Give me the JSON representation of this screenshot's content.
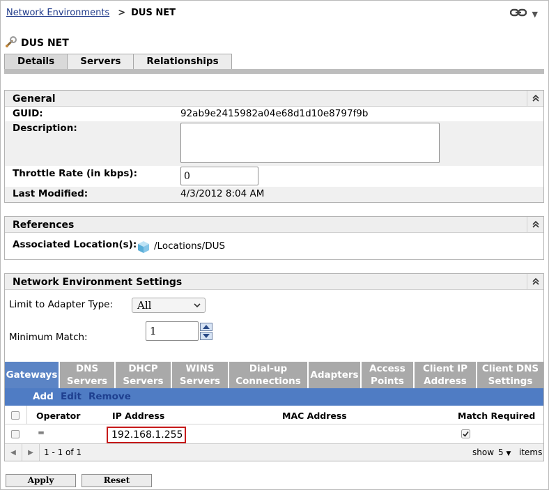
{
  "breadcrumb": {
    "parent": "Network Environments",
    "separator": ">",
    "current": "DUS NET"
  },
  "header": {
    "title": "DUS NET",
    "menu_arrow": "▼"
  },
  "tabs": [
    {
      "label": "Details"
    },
    {
      "label": "Servers"
    },
    {
      "label": "Relationships"
    }
  ],
  "general": {
    "title": "General",
    "guid_label": "GUID:",
    "guid_value": "92ab9e2415982a04e68d1d10e8797f9b",
    "description_label": "Description:",
    "description_value": "",
    "throttle_label": "Throttle Rate (in kbps):",
    "throttle_value": "0",
    "modified_label": "Last Modified:",
    "modified_value": "4/3/2012 8:04 AM"
  },
  "references": {
    "title": "References",
    "location_label": "Associated Location(s):",
    "location_value": "/Locations/DUS"
  },
  "settings": {
    "title": "Network Environment Settings",
    "adapter_label": "Limit to Adapter Type:",
    "adapter_value": "All",
    "min_match_label": "Minimum Match:",
    "min_match_value": "1",
    "subtabs": [
      {
        "line1": "Gateways",
        "line2": ""
      },
      {
        "line1": "DNS",
        "line2": "Servers"
      },
      {
        "line1": "DHCP",
        "line2": "Servers"
      },
      {
        "line1": "WINS",
        "line2": "Servers"
      },
      {
        "line1": "Dial-up",
        "line2": "Connections"
      },
      {
        "line1": "Adapters",
        "line2": ""
      },
      {
        "line1": "Access",
        "line2": "Points"
      },
      {
        "line1": "Client IP",
        "line2": "Address"
      },
      {
        "line1": "Client DNS",
        "line2": "Settings"
      }
    ],
    "actions": {
      "add": "Add",
      "edit": "Edit",
      "remove": "Remove"
    },
    "columns": {
      "operator": "Operator",
      "ip": "IP Address",
      "mac": "MAC Address",
      "match": "Match Required"
    },
    "rows": [
      {
        "operator": "=",
        "ip": "192.168.1.255",
        "mac": "",
        "match_required": true
      }
    ],
    "pager": {
      "range": "1 - 1 of 1",
      "show_label": "show",
      "page_size": "5",
      "items_label": "items"
    }
  },
  "buttons": {
    "apply": "Apply",
    "reset": "Reset"
  },
  "colors": {
    "active_subtab": "#5b84c5",
    "action_bar": "#4f7cc4",
    "highlight_border": "#c61a1a",
    "link": "#1f3a8a"
  }
}
